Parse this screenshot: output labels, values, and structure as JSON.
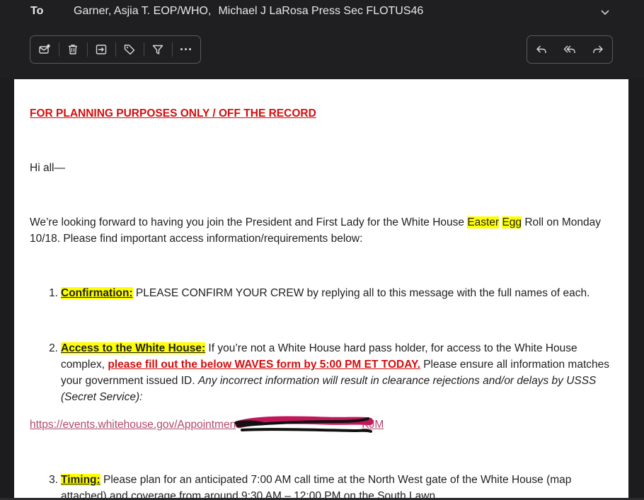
{
  "header": {
    "to_label": "To",
    "recipients": [
      "Garner, Asjia T. EOP/WHO,",
      "Michael J LaRosa Press Sec FLOTUS46"
    ]
  },
  "toolbar_left": [
    {
      "icon": "mark-unread-icon"
    },
    {
      "icon": "trash-icon"
    },
    {
      "icon": "move-to-icon"
    },
    {
      "icon": "tag-icon"
    },
    {
      "icon": "filter-icon"
    },
    {
      "icon": "more-icon",
      "glyph": "···"
    }
  ],
  "toolbar_right": [
    {
      "icon": "reply-icon"
    },
    {
      "icon": "reply-all-icon"
    },
    {
      "icon": "forward-icon"
    }
  ],
  "email": {
    "heading": "FOR PLANNING PURPOSES ONLY / OFF THE RECORD",
    "greeting": "Hi all—",
    "intro_1": "We’re looking forward to having you join the President and First Lady for the White House ",
    "intro_hl1": "Easter",
    "intro_hl2": "Egg",
    "intro_2": " Roll on Monday",
    "intro_3": "10/18. Please find important access information/requirements below:",
    "item1_num": "1.",
    "item1_label": "Confirmation:",
    "item1_text": " PLEASE CONFIRM YOUR CREW by replying all to this message with the full names of each.",
    "item2_num": "2.",
    "item2_label": "Access to the White House:",
    "item2_text1": " If you’re not a White House hard pass holder, for access to the White House",
    "item2_text2a": "complex, ",
    "item2_red": "please fill out the below WAVES form by 5:00 PM ET TODAY.",
    "item2_text2b": " Please ensure all information matches",
    "item2_text3a": "your government issued ID. ",
    "item2_italic1": "Any incorrect information will result in clearance rejections and/or delays by USSS",
    "item2_italic2": "(Secret Service):",
    "link_start": "https://events.whitehouse.gov/Appointmen",
    "link_end": "KJM",
    "item3_num": "3.",
    "item3_label": "Timing:",
    "item3_text1": " Please plan for an anticipated 7:00 AM call time at the North West gate of the White House (map",
    "item3_text2": "attached) and coverage from around 9:30 AM – 12:00 PM on the South Lawn."
  },
  "colors": {
    "dark_bg": "#1f1f21",
    "heading_red": "#d40d0d",
    "highlight": "#ffff00",
    "link": "#b04a6e",
    "redaction_pink": "#c2185b"
  }
}
